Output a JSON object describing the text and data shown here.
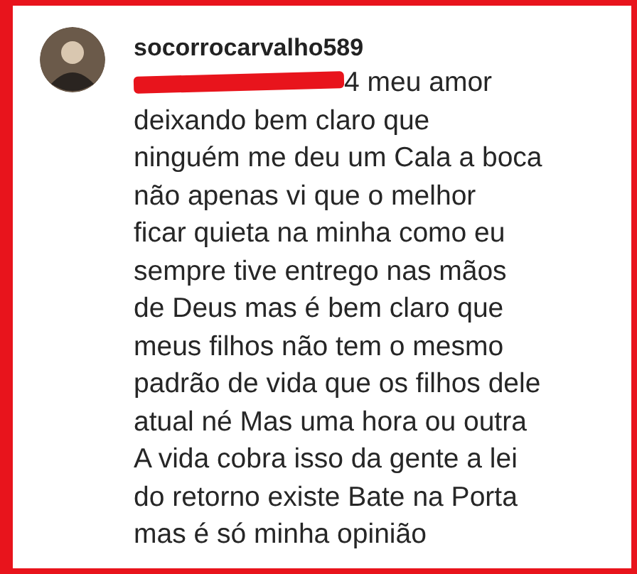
{
  "comment": {
    "username": "socorrocarvalho589",
    "redacted_mention": true,
    "lines": [
      "4 meu amor",
      "deixando bem claro que",
      "ninguém me deu um Cala a boca",
      "não apenas vi que o melhor",
      "ficar quieta na minha como eu",
      "sempre tive entrego nas mãos",
      "de Deus mas é bem claro que",
      "meus filhos não tem o mesmo",
      "padrão de vida que os filhos dele",
      "atual né Mas uma hora ou outra",
      "A vida cobra isso da gente a lei",
      "do retorno existe Bate na Porta",
      "mas é só minha opinião"
    ]
  }
}
